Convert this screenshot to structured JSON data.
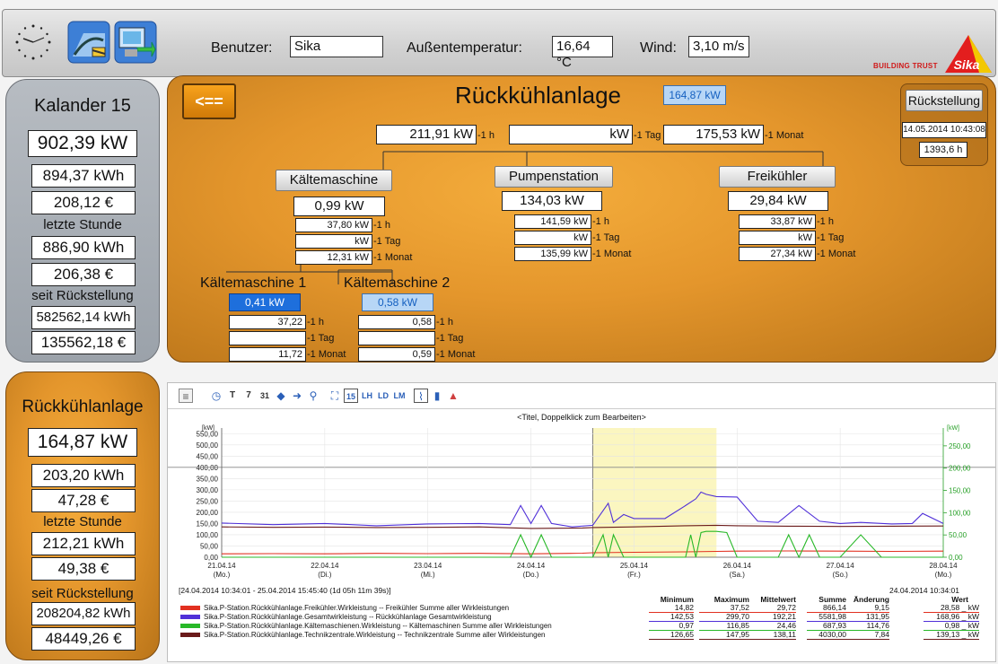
{
  "topbar": {
    "user_label": "Benutzer:",
    "user_value": "Sika",
    "temp_label": "Außentemperatur:",
    "temp_value": "16,64 °C",
    "wind_label": "Wind:",
    "wind_value": "3,10 m/s",
    "brand_tagline": "BUILDING TRUST",
    "brand_logo": "Sika"
  },
  "left_top": {
    "title": "Kalander 15",
    "power": "902,39 kW",
    "energy1": "894,37 kWh",
    "cost1": "208,12 €",
    "label_hour": "letzte Stunde",
    "energy2": "886,90 kWh",
    "cost2": "206,38 €",
    "label_reset": "seit Rückstellung",
    "energy3": "582562,14 kWh",
    "cost3": "135562,18 €"
  },
  "left_bottom": {
    "title": "Rückkühlanlage",
    "power": "164,87 kW",
    "energy1": "203,20 kWh",
    "cost1": "47,28 €",
    "label_hour": "letzte Stunde",
    "energy2": "212,21 kWh",
    "cost2": "49,38 €",
    "label_reset": "seit Rückstellung",
    "energy3": "208204,82 kWh",
    "cost3": "48449,26 €"
  },
  "main": {
    "back_button": "<==",
    "title": "Rückkühlanlage",
    "title_power": "164,87 kW",
    "total_1h": "211,91 kW",
    "total_1tag": "kW",
    "total_1monat": "175,53 kW",
    "lbl_1h": "-1 h",
    "lbl_1tag": "-1 Tag",
    "lbl_1monat": "-1 Monat",
    "reset_button": "Rückstellung",
    "reset_date": "14.05.2014 10:43:08",
    "reset_hours": "1393,6 h",
    "kaelte": {
      "button": "Kältemaschine",
      "power": "0,99 kW",
      "v1h": "37,80 kW",
      "v1tag": "kW",
      "v1monat": "12,31 kW"
    },
    "pumpen": {
      "button": "Pumpenstation",
      "power": "134,03 kW",
      "v1h": "141,59 kW",
      "v1tag": "kW",
      "v1monat": "135,99 kW"
    },
    "frei": {
      "button": "Freikühler",
      "power": "29,84 kW",
      "v1h": "33,87 kW",
      "v1tag": "kW",
      "v1monat": "27,34 kW"
    },
    "km1": {
      "title": "Kältemaschine 1",
      "power": "0,41 kW",
      "v1h": "37,22",
      "v1tag": "",
      "v1monat": "11,72"
    },
    "km2": {
      "title": "Kältemaschine 2",
      "power": "0,58 kW",
      "v1h": "0,58",
      "v1tag": "",
      "v1monat": "0,59"
    }
  },
  "chart_header": {
    "toolbar_icons": [
      "menu-icon",
      "clock-icon",
      "day-1-icon",
      "day-7-icon",
      "day-31-icon",
      "arrow-left-icon",
      "arrow-right-icon",
      "zoom-icon",
      "chart-mode-icon",
      "chart-15-icon",
      "chart-lh-icon",
      "chart-ld-icon",
      "chart-lm-icon",
      "chart-line-icon",
      "chart-bar-icon",
      "chart-area-icon"
    ],
    "toolbar_text": [
      "T",
      "7",
      "31",
      "15",
      "LH",
      "LD",
      "LM"
    ],
    "title_placeholder": "<Titel, Doppelklick zum Bearbeiten>",
    "range_text": "[24.04.2014 10:34:01  -  25.04.2014 15:45:40 (1d 05h 11m 39s)]",
    "cursor_time": "24.04.2014 10:34:01",
    "stat_headers": [
      "Minimum",
      "Maximum",
      "Mittelwert",
      "Summe",
      "Änderung",
      "Wert"
    ]
  },
  "chart_data": {
    "type": "line",
    "title": "<Titel, Doppelklick zum Bearbeiten>",
    "y_left_unit": "[kW]",
    "y_right_unit": "[kW]",
    "y_left_ticks": [
      "550,00",
      "500,00",
      "450,00",
      "400,00",
      "350,00",
      "300,00",
      "250,00",
      "200,00",
      "150,00",
      "100,00",
      "50,00",
      "0,00"
    ],
    "y_right_ticks": [
      "250,00",
      "200,00",
      "150,00",
      "100,00",
      "50,00",
      "0,00"
    ],
    "ylim_left": [
      0,
      575
    ],
    "ylim_right": [
      0,
      290
    ],
    "x_ticks": [
      {
        "date": "21.04.14",
        "day": "(Mo.)"
      },
      {
        "date": "22.04.14",
        "day": "(Di.)"
      },
      {
        "date": "23.04.14",
        "day": "(Mi.)"
      },
      {
        "date": "24.04.14",
        "day": "(Do.)"
      },
      {
        "date": "25.04.14",
        "day": "(Fr.)"
      },
      {
        "date": "26.04.14",
        "day": "(Sa.)"
      },
      {
        "date": "27.04.14",
        "day": "(So.)"
      },
      {
        "date": "28.04.14",
        "day": "(Mo.)"
      }
    ],
    "xlim_days": [
      0,
      7
    ],
    "highlight_range_days": [
      3.6,
      4.8
    ],
    "grid": true,
    "series": [
      {
        "name": "Sika.P-Station.Rückkühlanlage.Freikühler.Wirkleistung -- Freikühler Summe aller Wirkleistungen",
        "color": "#e23020",
        "x": [
          0,
          0.5,
          1,
          1.5,
          2,
          2.5,
          3,
          3.5,
          3.6,
          4,
          4.5,
          4.8,
          5,
          5.5,
          6,
          6.5,
          7
        ],
        "y": [
          15,
          16,
          15,
          17,
          16,
          17,
          15,
          18,
          20,
          22,
          24,
          26,
          27,
          28,
          27,
          26,
          27
        ],
        "min": "14,82",
        "max": "37,52",
        "mean": "29,72",
        "sum": "866,14",
        "change": "9,15",
        "value": "28,58 _ kW"
      },
      {
        "name": "Sika.P-Station.Rückkühlanlage.Gesamtwirkleistung -- Rückkühlanlage Gesamtwirkleistung",
        "color": "#5030d8",
        "x": [
          0,
          0.5,
          1,
          1.5,
          2,
          2.5,
          2.8,
          2.9,
          3.0,
          3.1,
          3.2,
          3.4,
          3.6,
          3.75,
          3.8,
          3.9,
          4.0,
          4.3,
          4.5,
          4.6,
          4.65,
          4.7,
          4.8,
          5.0,
          5.2,
          5.4,
          5.6,
          5.8,
          6.0,
          6.2,
          6.5,
          6.7,
          6.8,
          7
        ],
        "y": [
          152,
          145,
          150,
          140,
          148,
          150,
          145,
          230,
          150,
          230,
          150,
          135,
          142,
          240,
          155,
          190,
          172,
          172,
          230,
          260,
          290,
          280,
          270,
          268,
          160,
          155,
          230,
          160,
          150,
          155,
          148,
          150,
          195,
          150
        ],
        "min": "142,53",
        "max": "299,70",
        "mean": "192,21",
        "sum": "5581,98",
        "change": "131,95",
        "value": "168,96 _ kW"
      },
      {
        "name": "Sika.P-Station.Rückkühlanlage.Kältemaschienen.Wirkleistung -- Kältemaschinen Summe aller Wirkleistungen",
        "color": "#28b828",
        "x": [
          0,
          0.5,
          1,
          1.5,
          2,
          2.5,
          2.8,
          2.9,
          3.0,
          3.1,
          3.2,
          3.6,
          3.7,
          3.75,
          3.8,
          3.9,
          4.0,
          4.5,
          4.55,
          4.6,
          4.65,
          4.7,
          4.8,
          4.9,
          5.0,
          5.4,
          5.5,
          5.6,
          5.7,
          5.8,
          6.0,
          6.2,
          6.4,
          6.6,
          6.8,
          7
        ],
        "y": [
          0,
          0,
          0,
          0,
          0,
          0,
          0,
          100,
          0,
          100,
          0,
          0,
          100,
          0,
          100,
          0,
          0,
          0,
          100,
          0,
          110,
          115,
          115,
          110,
          0,
          0,
          100,
          0,
          100,
          0,
          0,
          100,
          0,
          0,
          0,
          0
        ],
        "min": "0,97",
        "max": "116,85",
        "mean": "24,46",
        "sum": "687,93",
        "change": "114,76",
        "value": "0,98 _ kW"
      },
      {
        "name": "Sika.P-Station.Rückkühlanlage.Technikzentrale.Wirkleistung -- Technikzentrale Summe aller Wirkleistungen",
        "color": "#6a1a1a",
        "x": [
          0,
          0.5,
          1,
          1.5,
          2,
          2.5,
          3,
          3.5,
          3.6,
          4,
          4.5,
          4.8,
          5,
          5.5,
          6,
          6.5,
          7
        ],
        "y": [
          135,
          133,
          134,
          132,
          133,
          135,
          128,
          130,
          132,
          135,
          140,
          142,
          140,
          138,
          137,
          138,
          139
        ],
        "min": "126,65",
        "max": "147,95",
        "mean": "138,11",
        "sum": "4030,00",
        "change": "7,84",
        "value": "139,13 _ kW"
      }
    ]
  }
}
